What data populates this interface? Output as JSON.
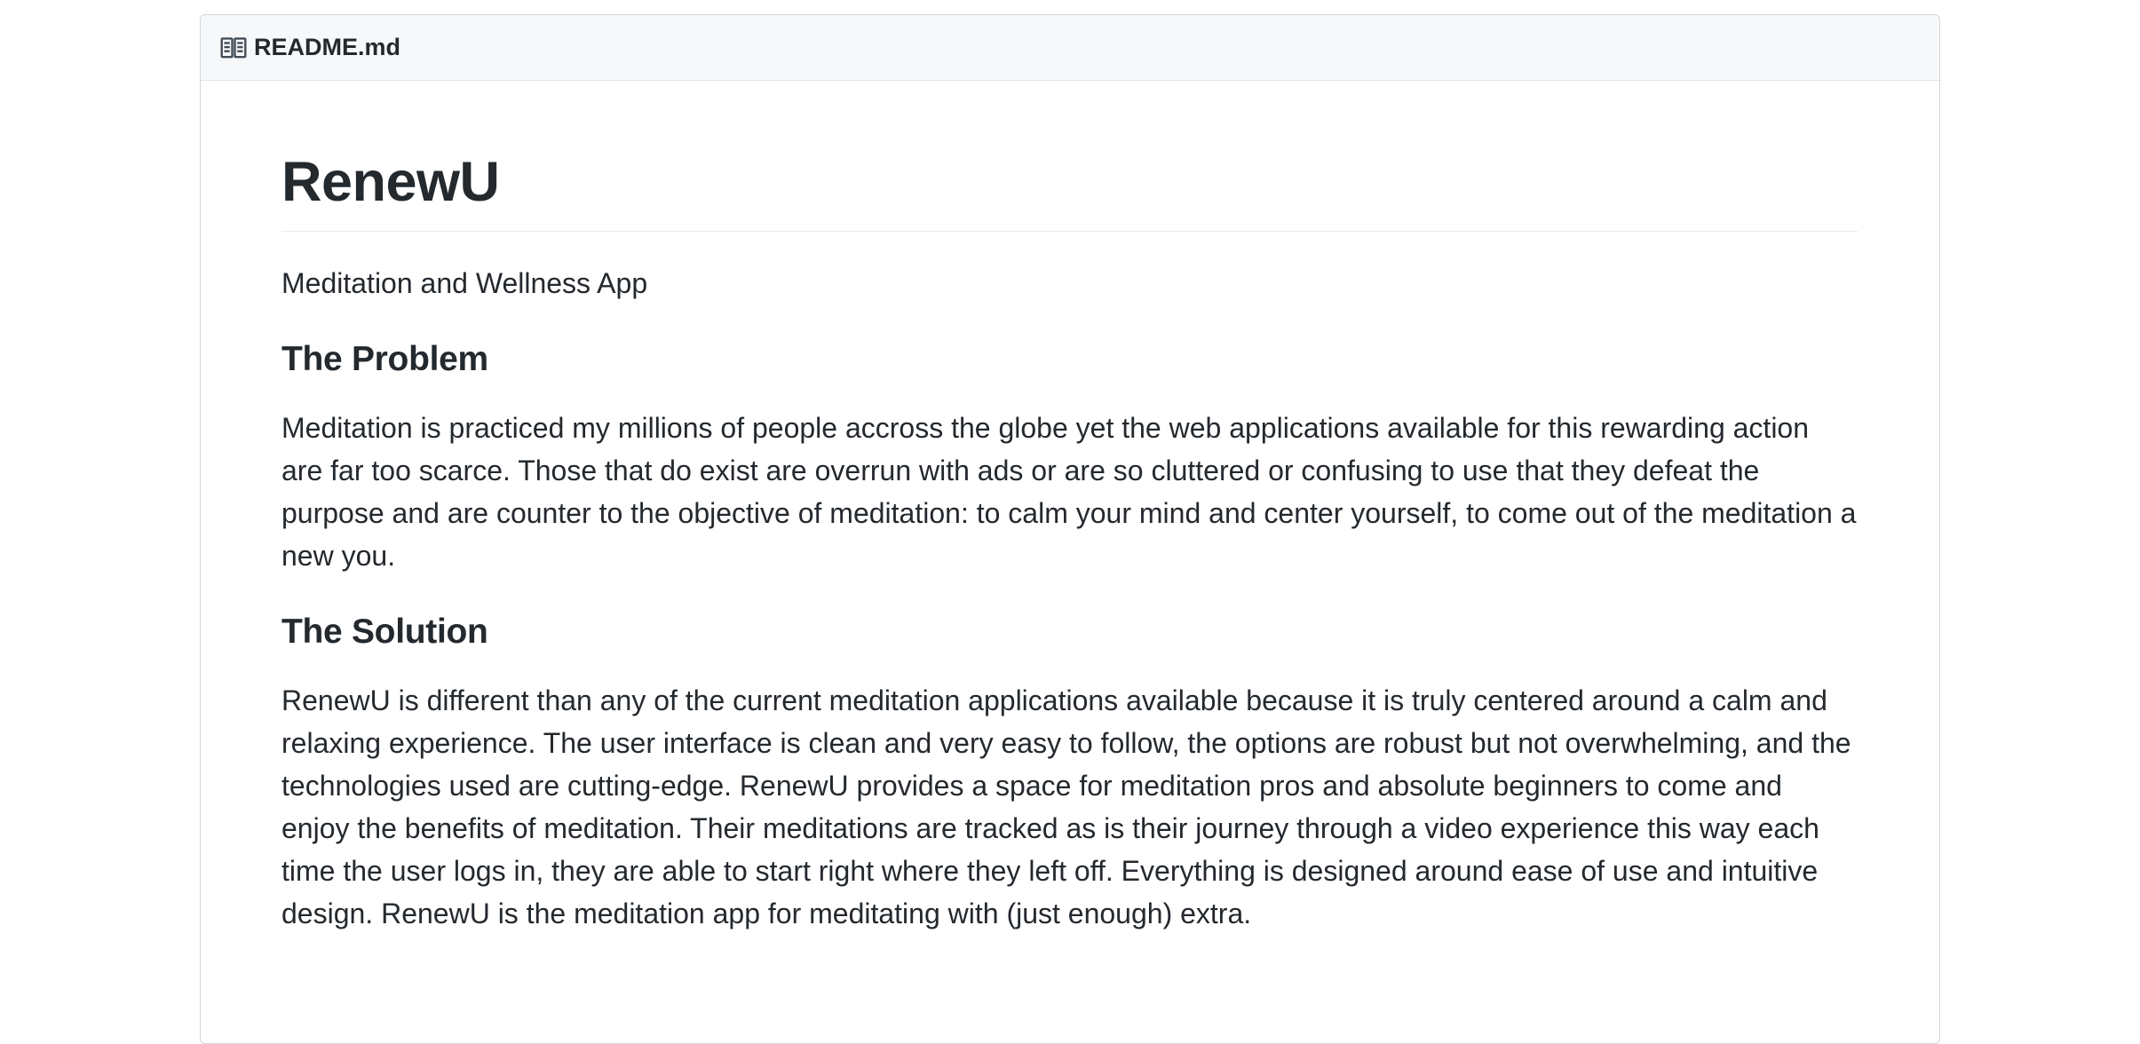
{
  "readme": {
    "filename": "README.md",
    "icon": "book-icon",
    "title": "RenewU",
    "subtitle": "Meditation and Wellness App",
    "sections": [
      {
        "heading": "The Problem",
        "body": "Meditation is practiced my millions of people accross the globe yet the web applications available for this rewarding action are far too scarce. Those that do exist are overrun with ads or are so cluttered or confusing to use that they defeat the purpose and are counter to the objective of meditation: to calm your mind and center yourself, to come out of the meditation a new you."
      },
      {
        "heading": "The Solution",
        "body": "RenewU is different than any of the current meditation applications available because it is truly centered around a calm and relaxing experience. The user interface is clean and very easy to follow, the options are robust but not overwhelming, and the technologies used are cutting-edge. RenewU provides a space for meditation pros and absolute beginners to come and enjoy the benefits of meditation. Their meditations are tracked as is their journey through a video experience this way each time the user logs in, they are able to start right where they left off. Everything is designed around ease of use and intuitive design. RenewU is the meditation app for meditating with (just enough) extra."
      }
    ]
  }
}
